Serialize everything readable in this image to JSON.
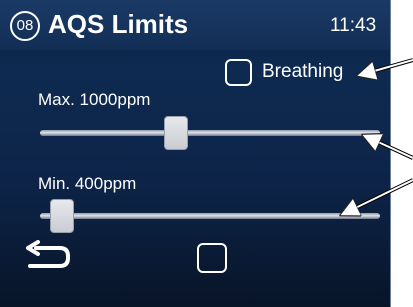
{
  "header": {
    "screen_number": "08",
    "title": "AQS Limits",
    "clock": "11:43"
  },
  "breathing": {
    "label": "Breathing",
    "checked": false
  },
  "sliders": [
    {
      "label": "Max. 1000ppm",
      "position_fraction": 0.4
    },
    {
      "label": "Min. 400ppm",
      "position_fraction": 0.065
    }
  ],
  "footer": {
    "back_icon": "back-arrow-icon",
    "home_icon": "square-home-icon"
  },
  "colors": {
    "background": "#0d2448",
    "text": "#ffffff",
    "track": "#c5cad3",
    "thumb": "#d6d9de"
  }
}
